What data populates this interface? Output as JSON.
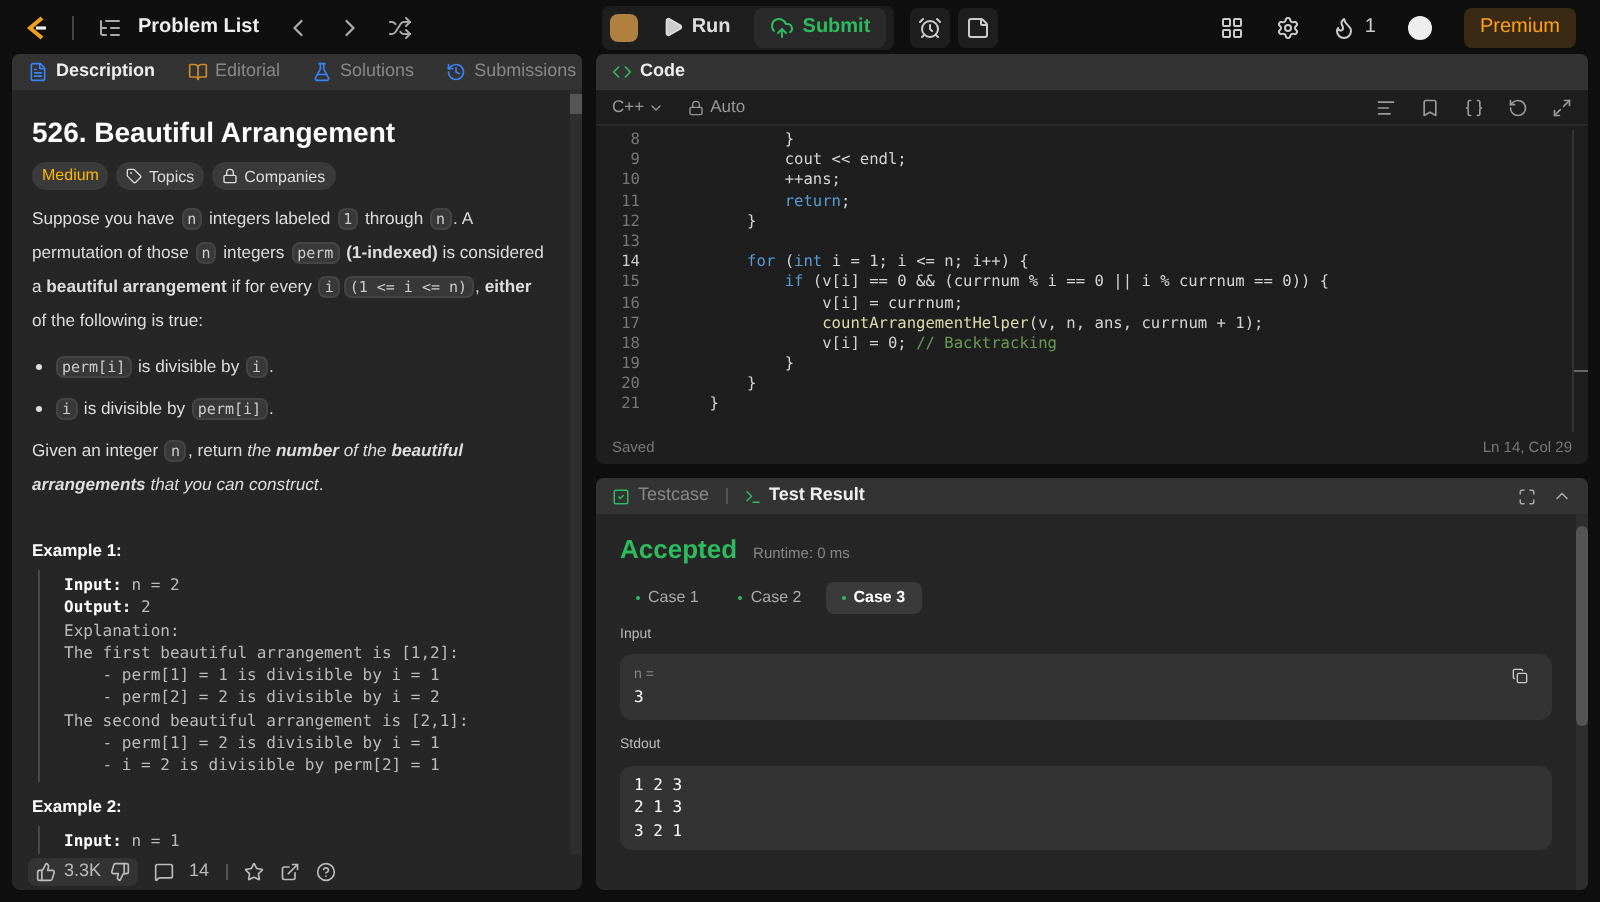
{
  "topbar": {
    "problem_list": "Problem List",
    "run": "Run",
    "submit": "Submit",
    "streak": "1",
    "premium": "Premium"
  },
  "description_panel": {
    "tabs": [
      {
        "label": "Description",
        "selected": true,
        "kind": "doc"
      },
      {
        "label": "Editorial",
        "selected": false,
        "kind": "book"
      },
      {
        "label": "Solutions",
        "selected": false,
        "kind": "flask"
      },
      {
        "label": "Submissions",
        "selected": false,
        "kind": "clock"
      }
    ],
    "title": "526. Beautiful Arrangement",
    "difficulty": "Medium",
    "tags": [
      {
        "label": "Topics",
        "kind": "tag"
      },
      {
        "label": "Companies",
        "kind": "lock"
      }
    ],
    "paragraphs": [
      [
        {
          "kind": "text",
          "t": "Suppose you have "
        },
        {
          "kind": "code",
          "t": "n"
        },
        {
          "kind": "text",
          "t": " integers labeled "
        },
        {
          "kind": "code",
          "t": "1"
        },
        {
          "kind": "text",
          "t": " through "
        },
        {
          "kind": "code",
          "t": "n"
        },
        {
          "kind": "text",
          "t": ". A permutation of those "
        },
        {
          "kind": "code",
          "t": "n"
        },
        {
          "kind": "text",
          "t": " integers "
        },
        {
          "kind": "code",
          "t": "perm"
        },
        {
          "kind": "text",
          "t": " **(1-indexed)** is considered a **beautiful arrangement** if for every "
        },
        {
          "kind": "code",
          "t": "i"
        },
        {
          "kind": "code",
          "t": "(1 <= i <= n)"
        },
        {
          "kind": "text",
          "t": ", **either** of the following is true:"
        }
      ]
    ],
    "bullets": [
      [
        {
          "kind": "code",
          "t": "perm[i]"
        },
        {
          "kind": "text",
          "t": " is divisible by "
        },
        {
          "kind": "code",
          "t": "i"
        },
        {
          "kind": "text",
          "t": "."
        }
      ],
      [
        {
          "kind": "code",
          "t": "i"
        },
        {
          "kind": "text",
          "t": " is divisible by "
        },
        {
          "kind": "code",
          "t": "perm[i]"
        },
        {
          "kind": "text",
          "t": "."
        }
      ]
    ],
    "closing": [
      {
        "kind": "text",
        "t": "Given an integer "
      },
      {
        "kind": "code",
        "t": "n"
      },
      {
        "kind": "text",
        "t": ", return "
      },
      {
        "kind": "italic",
        "t": "the **number** of the **beautiful arrangements** that you can construct"
      },
      {
        "kind": "text",
        "t": "."
      }
    ],
    "examples": [
      {
        "title": "Example 1:",
        "lines": [
          [
            {
              "kind": "label",
              "t": "Input:"
            },
            {
              "kind": "text",
              "t": " n = 2"
            }
          ],
          [
            {
              "kind": "label",
              "t": "Output:"
            },
            {
              "kind": "text",
              "t": " 2"
            }
          ],
          [
            {
              "kind": "text",
              "t": "Explanation:"
            }
          ],
          [
            {
              "kind": "text",
              "t": "The first beautiful arrangement is [1,2]:"
            }
          ],
          [
            {
              "kind": "text",
              "t": "    - perm[1] = 1 is divisible by i = 1"
            }
          ],
          [
            {
              "kind": "text",
              "t": "    - perm[2] = 2 is divisible by i = 2"
            }
          ],
          [
            {
              "kind": "text",
              "t": "The second beautiful arrangement is [2,1]:"
            }
          ],
          [
            {
              "kind": "text",
              "t": "    - perm[1] = 2 is divisible by i = 1"
            }
          ],
          [
            {
              "kind": "text",
              "t": "    - i = 2 is divisible by perm[2] = 1"
            }
          ]
        ]
      },
      {
        "title": "Example 2:",
        "lines": [
          [
            {
              "kind": "label",
              "t": "Input:"
            },
            {
              "kind": "text",
              "t": " n = 1"
            }
          ]
        ]
      }
    ],
    "footer": {
      "likes": "3.3K",
      "comments": "14"
    }
  },
  "code_panel": {
    "title": "Code",
    "language": "C++",
    "mode": "Auto",
    "status": "Saved",
    "cursor": "Ln 14, Col 29",
    "lines": [
      {
        "no": "8",
        "active": false,
        "tokens": [
          {
            "kind": "plain",
            "t": "            }"
          }
        ]
      },
      {
        "no": "9",
        "active": false,
        "tokens": [
          {
            "kind": "plain",
            "t": "            cout << endl;"
          }
        ]
      },
      {
        "no": "10",
        "active": false,
        "tokens": [
          {
            "kind": "plain",
            "t": "            ++ans;"
          }
        ]
      },
      {
        "no": "11",
        "active": false,
        "tokens": [
          {
            "kind": "keyword",
            "t": "            return"
          },
          {
            "kind": "plain",
            "t": ";"
          }
        ]
      },
      {
        "no": "12",
        "active": false,
        "tokens": [
          {
            "kind": "plain",
            "t": "        }"
          }
        ]
      },
      {
        "no": "13",
        "active": false
      },
      {
        "no": "14",
        "active": true,
        "tokens": [
          {
            "kind": "keyword",
            "t": "        for"
          },
          {
            "kind": "plain",
            "t": " ("
          },
          {
            "kind": "keyword",
            "t": "int"
          },
          {
            "kind": "plain",
            "t": " i = 1; i <= n; i++) {"
          }
        ]
      },
      {
        "no": "15",
        "active": false,
        "tokens": [
          {
            "kind": "keyword",
            "t": "            if"
          },
          {
            "kind": "plain",
            "t": " (v[i] == 0 && (currnum % i == 0 || i % currnum == 0)) {"
          }
        ]
      },
      {
        "no": "16",
        "active": false,
        "tokens": [
          {
            "kind": "plain",
            "t": "                v[i] = currnum;"
          }
        ]
      },
      {
        "no": "17",
        "active": false,
        "tokens": [
          {
            "kind": "function",
            "t": "                countArrangementHelper"
          },
          {
            "kind": "plain",
            "t": "(v, n, ans, currnum + 1);"
          }
        ]
      },
      {
        "no": "18",
        "active": false,
        "tokens": [
          {
            "kind": "plain",
            "t": "                v[i] = 0; "
          },
          {
            "kind": "comment",
            "t": "// Backtracking"
          }
        ]
      },
      {
        "no": "19",
        "active": false,
        "tokens": [
          {
            "kind": "plain",
            "t": "            }"
          }
        ]
      },
      {
        "no": "20",
        "active": false,
        "tokens": [
          {
            "kind": "plain",
            "t": "        }"
          }
        ]
      },
      {
        "no": "21",
        "active": false,
        "tokens": [
          {
            "kind": "plain",
            "t": "    }"
          }
        ]
      }
    ]
  },
  "result_panel": {
    "tabs": [
      {
        "label": "Testcase",
        "selected": false
      },
      {
        "label": "Test Result",
        "selected": true
      }
    ],
    "verdict": "Accepted",
    "runtime": "Runtime: 0 ms",
    "cases": [
      {
        "label": "Case 1",
        "selected": false
      },
      {
        "label": "Case 2",
        "selected": false
      },
      {
        "label": "Case 3",
        "selected": true
      }
    ],
    "input_label": "Input",
    "input_name": "n =",
    "input_value": "3",
    "stdout_label": "Stdout",
    "stdout_lines": [
      "1 2 3",
      "2 1 3",
      "3 2 1"
    ]
  }
}
